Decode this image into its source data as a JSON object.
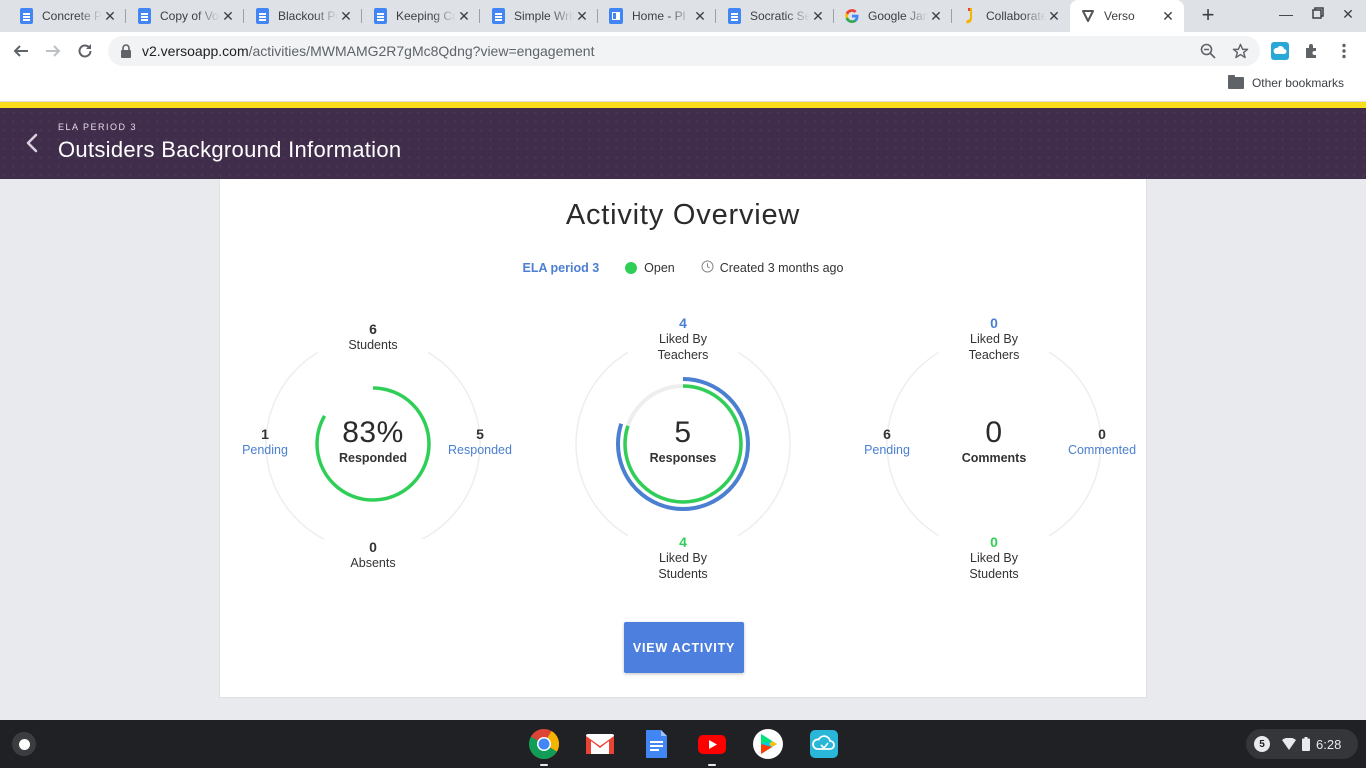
{
  "browser": {
    "tabs": [
      {
        "title": "Concrete Poem",
        "favicon": "google-docs-icon"
      },
      {
        "title": "Copy of Vocabulary",
        "favicon": "google-docs-icon"
      },
      {
        "title": "Blackout Poetry",
        "favicon": "google-docs-icon"
      },
      {
        "title": "Keeping Current",
        "favicon": "google-docs-icon"
      },
      {
        "title": "Simple Writing",
        "favicon": "google-docs-icon"
      },
      {
        "title": "Home - Pl",
        "favicon": "google-sites-icon"
      },
      {
        "title": "Socratic Seminar",
        "favicon": "google-docs-icon"
      },
      {
        "title": "Google Jamboard",
        "favicon": "google-icon"
      },
      {
        "title": "Collaborate",
        "favicon": "collaborate-icon"
      },
      {
        "title": "Verso",
        "favicon": "verso-icon",
        "active": true
      }
    ],
    "url_host": "v2.versoapp.com",
    "url_path": "/activities/MWMAMG2R7gMc8Qdng?view=engagement",
    "bookmarks": {
      "other": "Other bookmarks"
    }
  },
  "app_header": {
    "class_label": "ELA PERIOD 3",
    "title": "Outsiders Background Information"
  },
  "overview": {
    "title": "Activity Overview",
    "class_name": "ELA period 3",
    "status": "Open",
    "created": "Created 3 months ago",
    "colors": {
      "green": "#2fcf57",
      "blue": "#4a7fd1",
      "button": "#4c7fde",
      "header": "#402d4b",
      "accent": "#f7df1e"
    },
    "students": {
      "top": {
        "value": "6",
        "label": "Students"
      },
      "left": {
        "value": "1",
        "label": "Pending"
      },
      "right": {
        "value": "5",
        "label": "Responded"
      },
      "bottom": {
        "value": "0",
        "label": "Absents"
      },
      "center": {
        "value": "83%",
        "label": "Responded"
      },
      "progress_fraction": 0.833
    },
    "responses": {
      "top": {
        "value": "4",
        "label_line1": "Liked By",
        "label_line2": "Teachers"
      },
      "bottom": {
        "value": "4",
        "label_line1": "Liked By",
        "label_line2": "Students"
      },
      "center": {
        "value": "5",
        "label": "Responses"
      },
      "teacher_likes_fraction": 0.8,
      "student_likes_fraction": 0.8
    },
    "comments": {
      "top": {
        "value": "0",
        "label_line1": "Liked By",
        "label_line2": "Teachers"
      },
      "left": {
        "value": "6",
        "label": "Pending"
      },
      "right": {
        "value": "0",
        "label": "Commented"
      },
      "bottom": {
        "value": "0",
        "label_line1": "Liked By",
        "label_line2": "Students"
      },
      "center": {
        "value": "0",
        "label": "Comments"
      }
    },
    "button_label": "VIEW ACTIVITY"
  },
  "shelf": {
    "apps": [
      "chrome-icon",
      "gmail-icon",
      "google-docs-icon",
      "youtube-icon",
      "play-store-icon",
      "cloud-app-icon"
    ],
    "notification_count": "5",
    "time": "6:28"
  }
}
